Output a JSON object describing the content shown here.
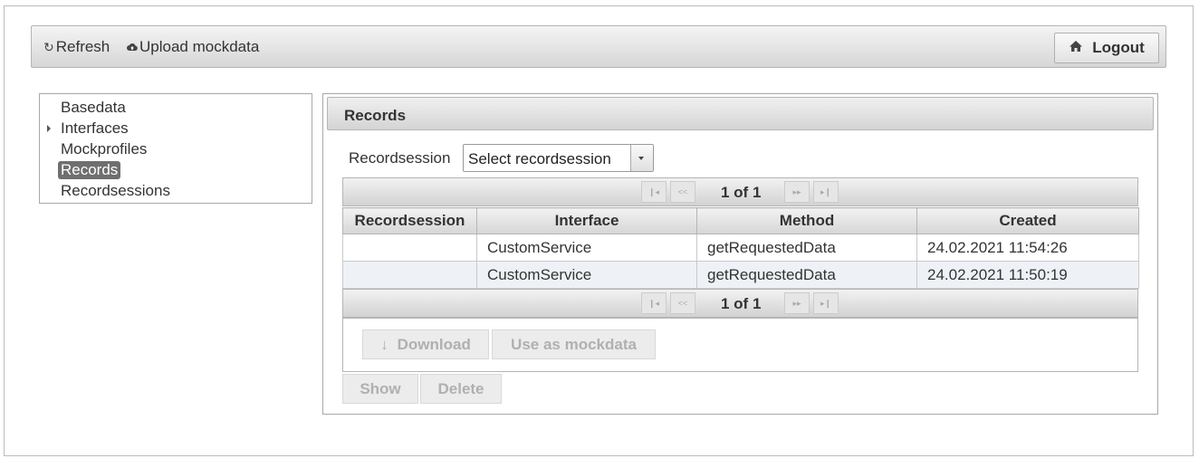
{
  "toolbar": {
    "refresh_label": "Refresh",
    "upload_label": "Upload mockdata",
    "logout_label": "Logout"
  },
  "nav": {
    "items": [
      {
        "label": "Basedata"
      },
      {
        "label": "Interfaces"
      },
      {
        "label": "Mockprofiles"
      },
      {
        "label": "Records"
      },
      {
        "label": "Recordsessions"
      }
    ],
    "selected": "Records"
  },
  "panel": {
    "title": "Records",
    "recordsession_label": "Recordsession",
    "recordsession_select": "Select recordsession"
  },
  "grid": {
    "pager_top": "1 of 1",
    "pager_bottom": "1 of 1",
    "columns": [
      "Recordsession",
      "Interface",
      "Method",
      "Created"
    ],
    "rows": [
      {
        "recordsession": "",
        "interface": "CustomService",
        "method": "getRequestedData",
        "created": "24.02.2021 11:54:26"
      },
      {
        "recordsession": "",
        "interface": "CustomService",
        "method": "getRequestedData",
        "created": "24.02.2021 11:50:19"
      }
    ]
  },
  "buttons": {
    "download": "Download",
    "use_as_mockdata": "Use as mockdata",
    "show": "Show",
    "delete": "Delete"
  },
  "icons": {
    "refresh": "refresh-icon",
    "upload": "cloud-upload-icon",
    "logout": "home-icon",
    "download": "arrow-down-icon"
  }
}
